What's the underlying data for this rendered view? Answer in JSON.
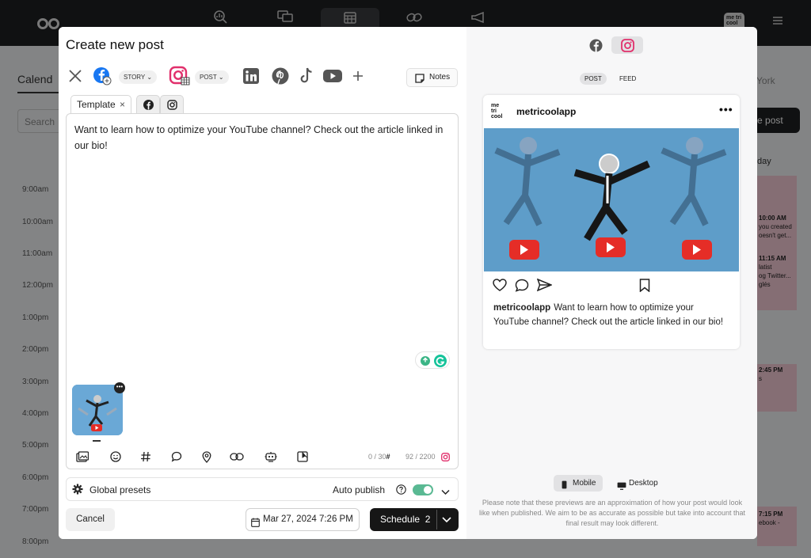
{
  "background": {
    "calendar_tab": "Calend",
    "search_placeholder": "Search",
    "times": [
      "9:00am",
      "10:00am",
      "11:00am",
      "12:00pm",
      "1:00pm",
      "2:00pm",
      "3:00pm",
      "4:00pm",
      "5:00pm",
      "6:00pm",
      "7:00pm",
      "8:00pm"
    ],
    "create_post": "ate post",
    "day_label": "day",
    "timezone": "York",
    "events": [
      {
        "time": "10:00 AM",
        "lines": [
          "you created",
          "oesn't get..."
        ]
      },
      {
        "time": "11:15 AM",
        "lines": [
          "latist",
          "og Twitter...",
          "glés"
        ]
      },
      {
        "time": "2:45 PM",
        "lines": [
          "s"
        ]
      },
      {
        "time": "7:15 PM",
        "lines": [
          "ebook -"
        ]
      }
    ],
    "brand_text": "me tri cool"
  },
  "modal": {
    "title": "Create new post",
    "networks": [
      "twitter-x",
      "facebook",
      "instagram",
      "linkedin",
      "pinterest",
      "tiktok",
      "youtube",
      "add"
    ],
    "facebook_format": "STORY",
    "instagram_format": "POST",
    "notes_label": "Notes",
    "template_tab": "Template",
    "template_close": "×",
    "post_text": "Want to learn how to optimize your YouTube channel? Check out the article linked in our bio!",
    "hashtag_counter": "0 / 30",
    "char_counter": "92 / 2200",
    "global_presets": "Global presets",
    "auto_publish": "Auto publish",
    "auto_publish_on": true,
    "cancel": "Cancel",
    "date": "Mar 27, 2024 7:26 PM",
    "schedule": "Schedule",
    "schedule_count": "2"
  },
  "preview": {
    "tabs": [
      "POST",
      "FEED"
    ],
    "active_tab": "POST",
    "account": "metricoolapp",
    "avatar_text": "me tri cool",
    "caption_user": "metricoolapp",
    "caption_text": "Want to learn how to optimize your YouTube channel? Check out the article linked in our bio!",
    "mobile": "Mobile",
    "desktop": "Desktop",
    "disclaimer": "Please note that these previews are an approximation of how your post would look like when published. We aim to be as accurate as possible but take into account that final result may look different."
  },
  "colors": {
    "instagram": "#e1306c",
    "facebook": "#1877f2",
    "toggle": "#5ab993",
    "youtube": "#e52d27",
    "dark": "#161616"
  }
}
